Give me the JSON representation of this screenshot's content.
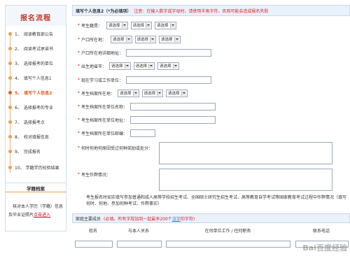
{
  "sidebar": {
    "title": "报名流程",
    "steps": [
      {
        "label": "1、　阅读教育部公告"
      },
      {
        "label": "2、　阅读考试承诺书"
      },
      {
        "label": "3、　选择报考的单位"
      },
      {
        "label": "4、　填写个人信息1"
      },
      {
        "label": "5、　填写个人信息2"
      },
      {
        "label": "6、　选择报考的专业"
      },
      {
        "label": "7、　选择报考点"
      },
      {
        "label": "8、　校对填报信息"
      },
      {
        "label": "9、　完成报名"
      },
      {
        "label": "10、 学籍学历校验结果"
      }
    ],
    "active_step_index": 4,
    "notice": {
      "title": "学籍档案",
      "text": "核对本人学历（学籍）信息及毕业证照片",
      "link": "点击进入"
    }
  },
  "form": {
    "header": {
      "title": "填写个人信息2（*为必填项）",
      "warning_prefix": "注意：在输入数字或字母时，请使用半角字符，否则可能会造成报名失败"
    },
    "select_placeholder": "请选择",
    "fields": {
      "native_place": "考生籍贯：",
      "hukou": "户口所在地：",
      "hukou_address": "户口所在地详细地址：",
      "birthplace": "出生地省市：",
      "study_unit": "现在学习或工作单位：",
      "archive_location": "考生档案所在地：",
      "archive_unit_name": "考生档案所在单位名称：",
      "archive_unit_address": "考生档案所在单位地址：",
      "archive_postcode": "考生档案所在单位邮编：",
      "rewards": "何时何地何原因受过何种奖励或处分：",
      "integrity": "考生作弊情况："
    },
    "integrity_note": "考生报名时如实填写参加普通和成人高等学校招生考试、全国硕士研究生招生考试、高等教育自学考试等国家教育考试过程中作弊情况（填写何时、何地、参加何种考试、作弊事实）"
  },
  "family": {
    "title": "家庭主要成员",
    "red_note": "(必填。所有字段加到一起最多200个",
    "link": "汉字",
    "red_note_suffix": "的字符)",
    "columns": [
      "姓名",
      "与本人关系",
      "在何单位工作 / 任何职务",
      "联系电话"
    ]
  },
  "watermark": "Bai百度经验"
}
